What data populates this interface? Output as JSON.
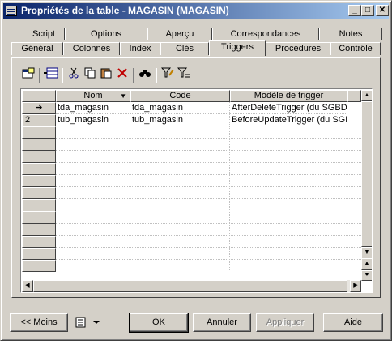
{
  "window": {
    "title": "Propriétés de la table - MAGASIN (MAGASIN)"
  },
  "tabs_back": [
    "Script",
    "Options",
    "Aperçu",
    "Correspondances",
    "Notes"
  ],
  "tabs_front": [
    "Général",
    "Colonnes",
    "Index",
    "Clés",
    "Triggers",
    "Procédures",
    "Contrôle"
  ],
  "active_tab": "Triggers",
  "grid": {
    "columns": [
      "Nom",
      "Code",
      "Modèle de trigger"
    ],
    "rows": [
      {
        "marker": "➜",
        "nom": "tda_magasin",
        "code": "tda_magasin",
        "modele": "AfterDeleteTrigger (du SGBD)"
      },
      {
        "marker": "2",
        "nom": "tub_magasin",
        "code": "tub_magasin",
        "modele": "BeforeUpdateTrigger (du SGBD)"
      }
    ]
  },
  "buttons": {
    "moins": "<< Moins",
    "ok": "OK",
    "annuler": "Annuler",
    "appliquer": "Appliquer",
    "aide": "Aide"
  },
  "title_buttons": {
    "minimize": "_",
    "maximize": "□",
    "close": "✕"
  }
}
